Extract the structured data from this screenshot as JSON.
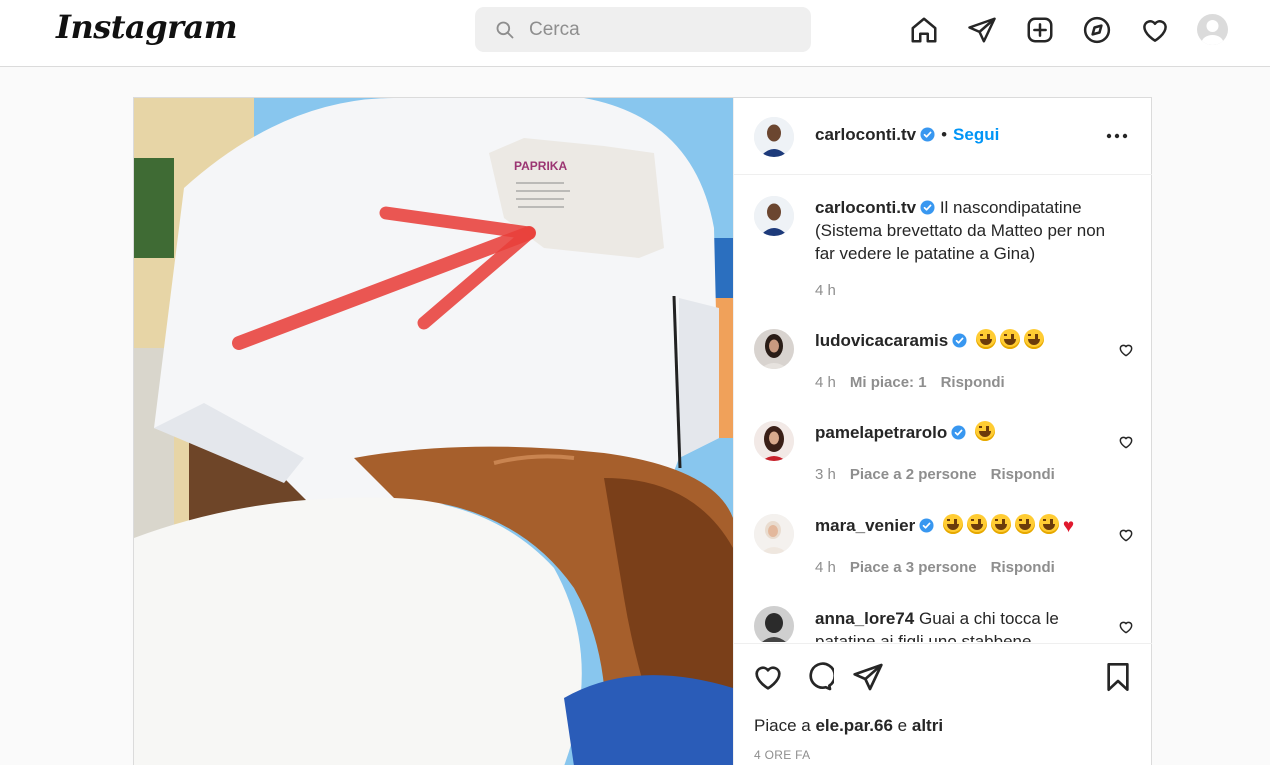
{
  "app": {
    "logo": "Instagram",
    "search": {
      "placeholder": "Cerca",
      "value": ""
    },
    "nav_icons": [
      "home-icon",
      "direct-icon",
      "new-post-icon",
      "explore-icon",
      "activity-icon",
      "profile-avatar"
    ]
  },
  "post": {
    "author": "carloconti.tv",
    "follow_label": "Segui",
    "separator": "•",
    "caption": {
      "username": "carloconti.tv",
      "text": "Il nascondipatatine (Sistema brevettato da Matteo per non far vedere le patatine a Gina)",
      "time": "4 h"
    },
    "comments": [
      {
        "username": "ludovicacaramis",
        "text": "",
        "emojis": [
          "laugh",
          "laugh",
          "laugh"
        ],
        "time": "4 h",
        "likes": "Mi piace: 1",
        "reply": "Rispondi"
      },
      {
        "username": "pamelapetrarolo",
        "text": "",
        "emojis": [
          "laugh"
        ],
        "time": "3 h",
        "likes": "Piace a 2 persone",
        "reply": "Rispondi"
      },
      {
        "username": "mara_venier",
        "text": "",
        "emojis": [
          "laugh",
          "laugh",
          "laugh",
          "laugh",
          "laugh",
          "heart"
        ],
        "time": "4 h",
        "likes": "Piace a 3 persone",
        "reply": "Rispondi"
      },
      {
        "username": "anna_lore74",
        "text": "Guai a chi tocca le patatine ai figli uno stabbene",
        "emojis": [],
        "time": "",
        "likes": "",
        "reply": ""
      }
    ],
    "liked_by_prefix": "Piace a ",
    "liked_by_user": "ele.par.66",
    "liked_by_mid": " e ",
    "liked_by_suffix": "altri",
    "posted_ago": "4 ORE FA",
    "image_annotation_text": "PAPRIKA"
  },
  "colors": {
    "accent": "#0095f6",
    "verified": "#3897f0",
    "text": "#262626",
    "muted": "#8e8e8e",
    "arrow": "#e8403a"
  }
}
